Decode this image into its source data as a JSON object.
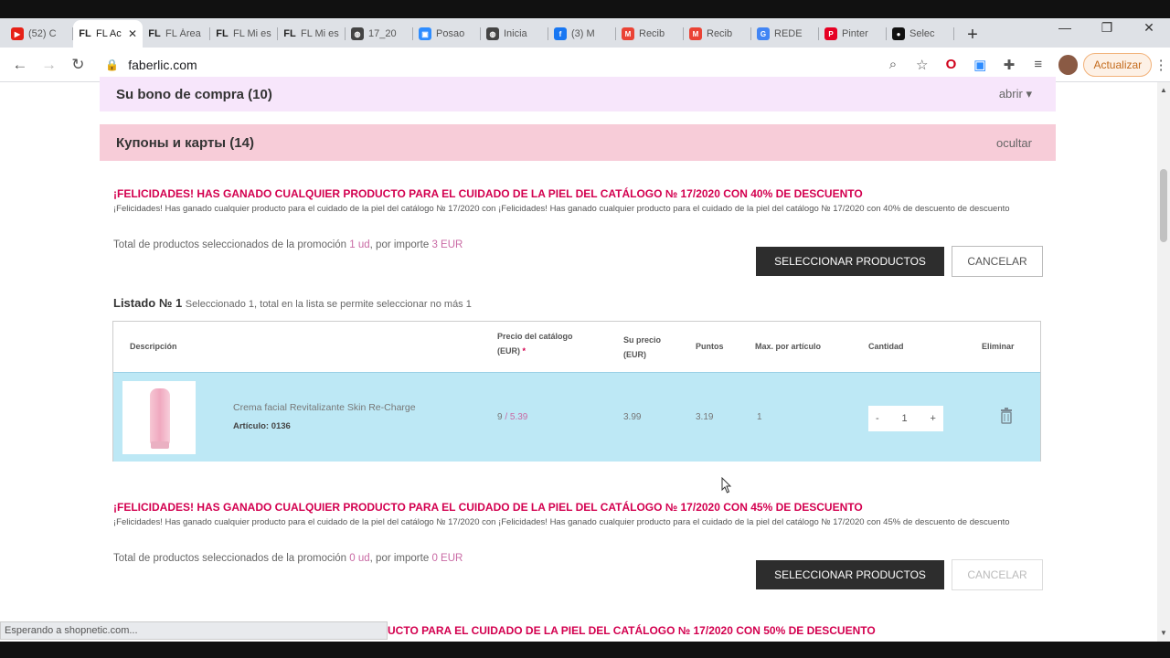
{
  "browser": {
    "tabs": [
      {
        "title": "(52) C",
        "icon": "youtube-icon",
        "color": "#e62117",
        "glyph": "▶"
      },
      {
        "title": "FL Ac",
        "icon": "faberlic-icon",
        "color": "#ffffff",
        "glyph": "FL",
        "active": true
      },
      {
        "title": "FL Área",
        "icon": "faberlic-icon",
        "color": "#ffffff",
        "glyph": "FL"
      },
      {
        "title": "FL Mi es",
        "icon": "faberlic-icon",
        "color": "#ffffff",
        "glyph": "FL"
      },
      {
        "title": "FL Mi es",
        "icon": "faberlic-icon",
        "color": "#ffffff",
        "glyph": "FL"
      },
      {
        "title": "17_20",
        "icon": "globe-icon",
        "color": "#444444",
        "glyph": "◍"
      },
      {
        "title": "Posao",
        "icon": "zoom-icon",
        "color": "#2d8cff",
        "glyph": "▣"
      },
      {
        "title": "Inicia",
        "icon": "globe-icon",
        "color": "#444444",
        "glyph": "◍"
      },
      {
        "title": "(3) M",
        "icon": "facebook-icon",
        "color": "#1877f2",
        "glyph": "f"
      },
      {
        "title": "Recib",
        "icon": "gmail-icon",
        "color": "#ea4335",
        "glyph": "M"
      },
      {
        "title": "Recib",
        "icon": "gmail-icon",
        "color": "#ea4335",
        "glyph": "M"
      },
      {
        "title": "REDE",
        "icon": "google-icon",
        "color": "#4285f4",
        "glyph": "G"
      },
      {
        "title": "Pinter",
        "icon": "pinterest-icon",
        "color": "#e60023",
        "glyph": "P"
      },
      {
        "title": "Selec",
        "icon": "chat-icon",
        "color": "#111111",
        "glyph": "●"
      }
    ],
    "url": "faberlic.com",
    "update_label": "Actualizar",
    "status_text": "Esperando a shopnetic.com..."
  },
  "panels": {
    "bono": {
      "label": "Su bono de compra (10)",
      "toggle": "abrir",
      "bg": "#f7e6fb"
    },
    "cupones": {
      "label": "Купоны и карты (14)",
      "toggle": "ocultar",
      "bg": "#f7ccd8"
    }
  },
  "promos": [
    {
      "title": "¡FELICIDADES! HAS GANADO CUALQUIER PRODUCTO PARA EL CUIDADO DE LA PIEL DEL CATÁLOGO № 17/2020 CON 40% DE DESCUENTO",
      "desc": "¡Felicidades! Has ganado cualquier producto para el cuidado de la piel del catálogo № 17/2020 con ¡Felicidades! Has ganado cualquier producto para el cuidado de la piel del catálogo № 17/2020 con 40% de descuento de descuento",
      "total_prefix": "Total de productos seleccionados de la promoción",
      "qty": "1 ud",
      "mid": ", por importe",
      "amount": "3 EUR",
      "select_label": "SELECCIONAR PRODUCTOS",
      "cancel_label": "CANCELAR"
    },
    {
      "title": "¡FELICIDADES! HAS GANADO CUALQUIER PRODUCTO PARA EL CUIDADO DE LA PIEL DEL CATÁLOGO № 17/2020 CON 45% DE DESCUENTO",
      "desc": "¡Felicidades! Has ganado cualquier producto para el cuidado de la piel del catálogo № 17/2020 con ¡Felicidades! Has ganado cualquier producto para el cuidado de la piel del catálogo № 17/2020 con 45% de descuento de descuento",
      "total_prefix": "Total de productos seleccionados de la promoción",
      "qty": "0 ud",
      "mid": ", por importe",
      "amount": "0 EUR",
      "select_label": "SELECCIONAR PRODUCTOS",
      "cancel_label": "CANCELAR"
    }
  ],
  "third_promo_title_partial": "UCTO PARA EL CUIDADO DE LA PIEL DEL CATÁLOGO № 17/2020 CON 50% DE DESCUENTO",
  "listado": {
    "title": "Listado № 1",
    "subtitle": "Seleccionado 1, total en la lista se permite seleccionar no más 1",
    "headers": {
      "desc": "Descripción",
      "precio_cat_1": "Precio del catálogo",
      "precio_cat_2": "(EUR)",
      "su_precio_1": "Su precio",
      "su_precio_2": "(EUR)",
      "puntos": "Puntos",
      "max": "Max. por artículo",
      "cantidad": "Cantidad",
      "eliminar": "Eliminar"
    },
    "item": {
      "name": "Crema facial Revitalizante Skin Re-Charge",
      "article": "Artículo: 0136",
      "price_catalog_old": "9",
      "price_catalog_new": "5.39",
      "su_precio": "3.99",
      "puntos": "3.19",
      "max": "1",
      "cantidad": "1",
      "minus": "-",
      "plus": "+"
    }
  }
}
